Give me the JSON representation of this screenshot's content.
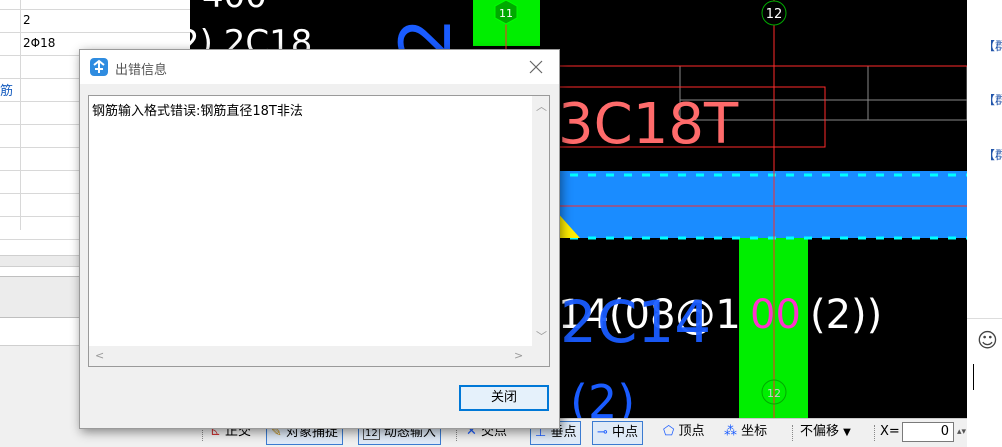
{
  "left_panel": {
    "row_values": [
      "2",
      "2Φ18"
    ],
    "category_label": "筋"
  },
  "canvas": {
    "axis_labels": [
      "11",
      "12",
      "12"
    ],
    "text_annotations": {
      "top_number": "400",
      "top_rebar": "2) 2C18",
      "big_blue_top": "2",
      "red_rebar": "3C18T",
      "lower_rebar": "14(08@1",
      "lower_rebar_pink": "00",
      "lower_rebar_end": "(2))",
      "blue_overlay": "2C14",
      "bottom_partial": "(2)"
    }
  },
  "dialog": {
    "title": "出错信息",
    "message": "钢筋输入格式错误:钢筋直径18T非法",
    "close_label": "关闭"
  },
  "right_panel": {
    "tag_label": "【群"
  },
  "statusbar": {
    "ortho": "正交",
    "object_snap": "对象捕捉",
    "dynamic_input": "动态输入",
    "intersection": "交点",
    "perpendicular": "垂点",
    "midpoint": "中点",
    "vertex": "顶点",
    "coordinate": "坐标",
    "offset_mode": "不偏移",
    "x_label": "X=",
    "x_value": "0"
  }
}
